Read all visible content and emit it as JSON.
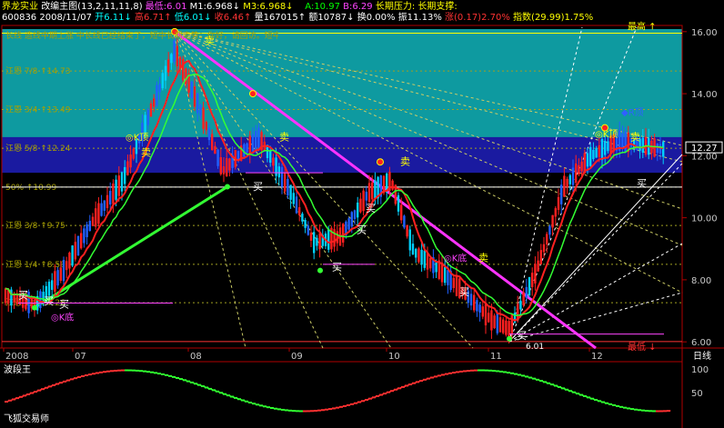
{
  "header": {
    "title": "界龙实业",
    "formula": "改编主图(13,2,11,11,8)",
    "hi_lo_ma": [
      {
        "text": "最低:6.01",
        "color": "#ff44ff"
      },
      {
        "text": "M1:6.968↓",
        "color": "#ffffff"
      },
      {
        "text": "M3:6.968↓",
        "color": "#ffff00"
      }
    ],
    "right_info": [
      {
        "text": "A:10.97",
        "color": "#00ff00"
      },
      {
        "text": "B:6.29",
        "color": "#ff44ff"
      },
      {
        "text": "长期压力:",
        "color": "#ffff00"
      },
      {
        "text": "长期支撑:",
        "color": "#ffff00"
      }
    ],
    "row2": [
      {
        "text": "600836",
        "color": "#ffffff"
      },
      {
        "text": "2008/11/07",
        "color": "#ffffff"
      },
      {
        "text": "开6.11↓",
        "color": "#00ffff"
      },
      {
        "text": "高6.71↑",
        "color": "#ff3333"
      },
      {
        "text": "低6.01↓",
        "color": "#00ffff"
      },
      {
        "text": "收6.46↑",
        "color": "#ff3333"
      },
      {
        "text": "量167015↑",
        "color": "#ffffff"
      },
      {
        "text": "额10787↓",
        "color": "#ffffff"
      },
      {
        "text": "换0.00%",
        "color": "#ffffff"
      },
      {
        "text": "振11.13%",
        "color": "#ffffff"
      },
      {
        "text": "涨(0.17)2.70%",
        "color": "#ff3333"
      },
      {
        "text": "指数(29.99)1.75%",
        "color": "#ffff00"
      }
    ],
    "row3": "长线  造线中期上涨  中长线已经结束了，短中长期走势：你好，请回访。短中长以月线结束",
    "indicator_label": "波段王",
    "footer_label": "飞狐交易师",
    "corner_label": "日线"
  },
  "chart_data": {
    "type": "candlestick",
    "ylim": [
      5.8,
      16.2
    ],
    "y_ticks": [
      6.0,
      8.0,
      10.0,
      12.0,
      14.0,
      16.0
    ],
    "x_ticks": [
      "2008",
      "07",
      "08",
      "09",
      "10",
      "11",
      "12"
    ],
    "last_price": "12.27",
    "fib_levels": [
      {
        "label": "江恩 7/8",
        "value": "14.73",
        "price": 14.73
      },
      {
        "label": "江恩 3/4",
        "value": "13.49",
        "price": 13.49
      },
      {
        "label": "江恩 5/8",
        "value": "12.24",
        "price": 12.24
      },
      {
        "label": "50%",
        "value": "10.99",
        "price": 10.99
      },
      {
        "label": "江恩 3/8",
        "value": "9.75",
        "price": 9.75
      },
      {
        "label": "江恩 1/4",
        "value": "8.50",
        "price": 8.5
      },
      {
        "label": "江恩 1/8",
        "value": "7.26",
        "price": 7.26
      }
    ],
    "high_label": "最高",
    "low_label": "最低",
    "low_value": "6.01",
    "signals": {
      "buy": "买",
      "sell": "卖",
      "k_top": "K顶",
      "k_bottom": "K底",
      "r_top": "R顶"
    },
    "oscillator": {
      "ticks": [
        "50",
        "100"
      ]
    }
  }
}
